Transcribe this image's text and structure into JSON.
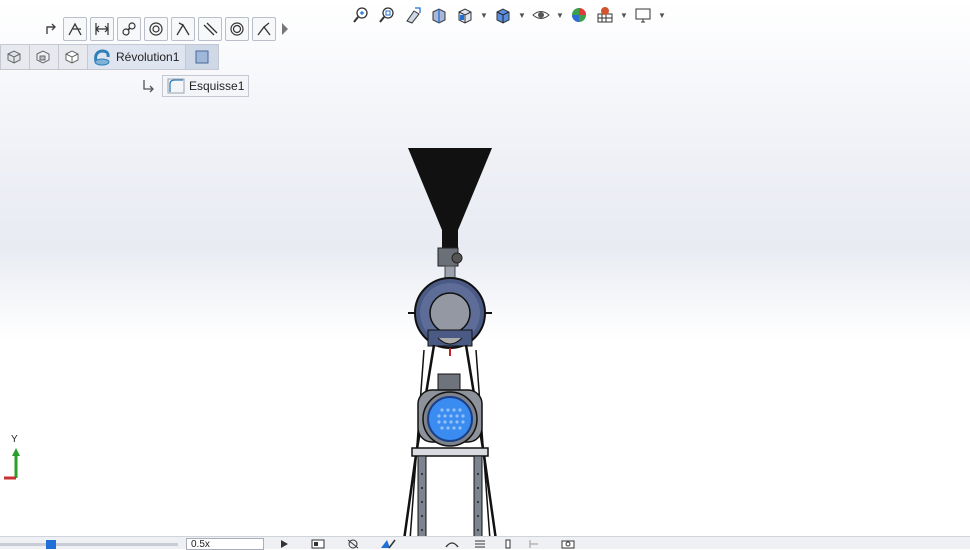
{
  "relations_toolbar": {
    "icons": [
      "arrow-return-icon",
      "horizontal-relation-icon",
      "distance-relation-icon",
      "tangent-relation-icon",
      "concentric-relation-icon",
      "coincident-relation-icon",
      "parallel-relation-icon",
      "coradial-relation-icon",
      "perpendicular-relation-icon",
      "expand-arrow-icon"
    ]
  },
  "view_toolbar": {
    "icons": [
      "zoom-to-fit-icon",
      "zoom-to-area-icon",
      "previous-view-icon",
      "section-view-icon",
      "view-orientation-icon",
      "display-style-icon",
      "hide-show-items-icon",
      "edit-appearance-icon",
      "apply-scene-icon",
      "view-settings-icon"
    ]
  },
  "breadcrumb": {
    "items": [
      {
        "icon": "part-icon",
        "label": ""
      },
      {
        "icon": "body-icon",
        "label": ""
      },
      {
        "icon": "solid-icon",
        "label": ""
      },
      {
        "icon": "revolve-icon",
        "label": "Révolution1"
      }
    ],
    "end_icon": "face-icon"
  },
  "sketch": {
    "label": "Esquisse1"
  },
  "triad": {
    "axis_label": "Y"
  },
  "bottom_bar": {
    "speed_value": "0.5x",
    "icons": [
      "play-icon",
      "record-icon",
      "animation-wizard-icon",
      "key-point-icon",
      "motion-study-icon",
      "spring-icon",
      "force-icon",
      "motor-icon",
      "contact-icon",
      "study-properties-icon"
    ]
  },
  "colors": {
    "accent": "#1f6fd6",
    "model_dark": "#111111",
    "model_body": "#4a5a84",
    "fan_blue": "#3a8cf0"
  }
}
